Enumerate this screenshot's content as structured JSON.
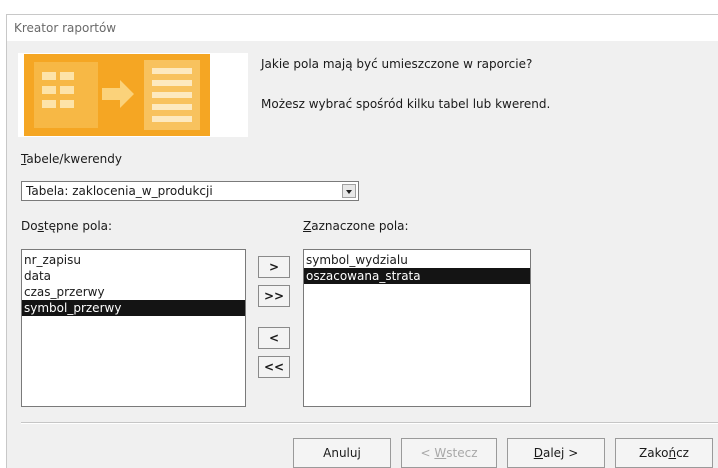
{
  "window": {
    "title": "Kreator raportów"
  },
  "intro": {
    "question": "Jakie pola mają być umieszczone w raporcie?",
    "hint": "Możesz wybrać spośród kilku tabel lub kwerend."
  },
  "source": {
    "label_key": "T",
    "label_rest": "abele/kwerendy",
    "selected": "Tabela: zaklocenia_w_produkcji"
  },
  "available": {
    "label_pre": "Do",
    "label_key": "s",
    "label_post": "tępne pola:",
    "items": [
      "nr_zapisu",
      "data",
      "czas_przerwy",
      "symbol_przerwy"
    ],
    "selected_index": 3
  },
  "chosen": {
    "label_key": "Z",
    "label_rest": "aznaczone pola:",
    "items": [
      "symbol_wydzialu",
      "oszacowana_strata"
    ],
    "selected_index": 1
  },
  "move_buttons": {
    "add": ">",
    "add_all": ">>",
    "remove": "<",
    "remove_all": "<<"
  },
  "footer": {
    "cancel": "Anuluj",
    "back_pre": "< ",
    "back_key": "W",
    "back_post": "stecz",
    "next_key": "D",
    "next_post": "alej >",
    "finish_pre": "Zako",
    "finish_key": "ń",
    "finish_post": "cz"
  },
  "colors": {
    "banner_orange": "#f5a623",
    "selection": "#141414"
  },
  "icons": {
    "banner": "wizard-report-graphic",
    "combo": "chevron-down-icon"
  }
}
